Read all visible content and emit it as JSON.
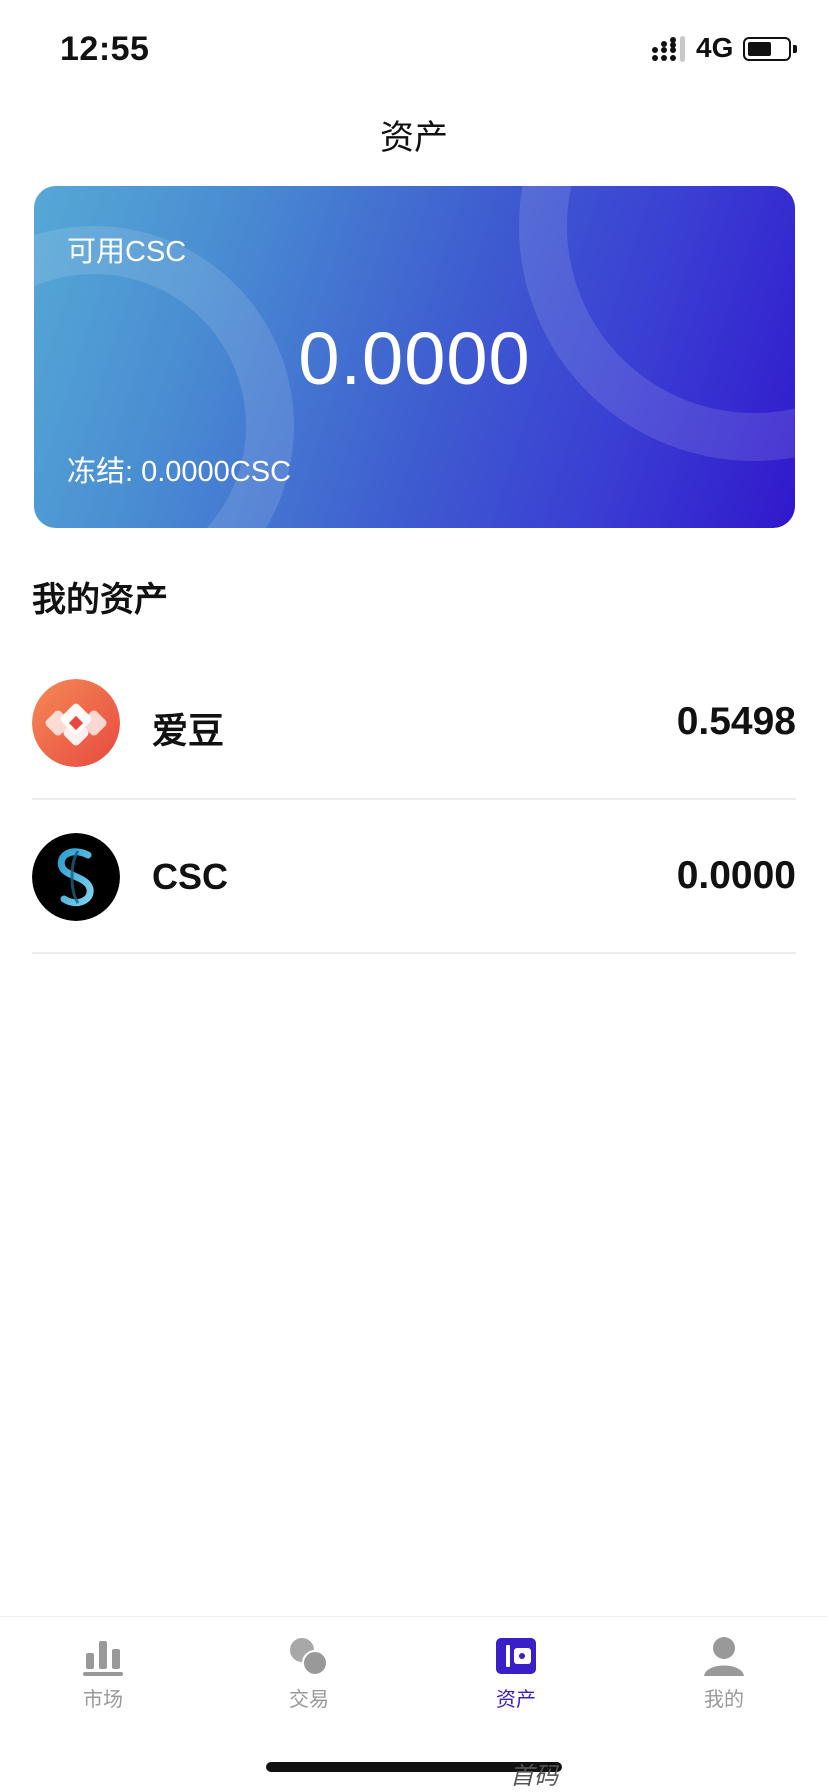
{
  "status_bar": {
    "time": "12:55",
    "network": "4G"
  },
  "page": {
    "title": "资产"
  },
  "balance_card": {
    "label": "可用CSC",
    "amount": "0.0000",
    "frozen": "冻结: 0.0000CSC",
    "gradient_colors": [
      "#56a8d6",
      "#3118cc"
    ]
  },
  "my_assets": {
    "title": "我的资产",
    "items": [
      {
        "name": "爱豆",
        "amount": "0.5498",
        "icon": "aidou-coin-icon",
        "color": "#ef5d4d"
      },
      {
        "name": "CSC",
        "amount": "0.0000",
        "icon": "csc-coin-icon",
        "color": "#000000"
      }
    ]
  },
  "tab_bar": {
    "active_color": "#3a1fc8",
    "inactive_color": "#999999",
    "tabs": [
      {
        "label": "市场",
        "icon": "bar-chart-icon"
      },
      {
        "label": "交易",
        "icon": "circles-icon"
      },
      {
        "label": "资产",
        "icon": "wallet-icon",
        "active": true
      },
      {
        "label": "我的",
        "icon": "user-icon"
      }
    ]
  },
  "home_indicator_ghost_text": "首码"
}
